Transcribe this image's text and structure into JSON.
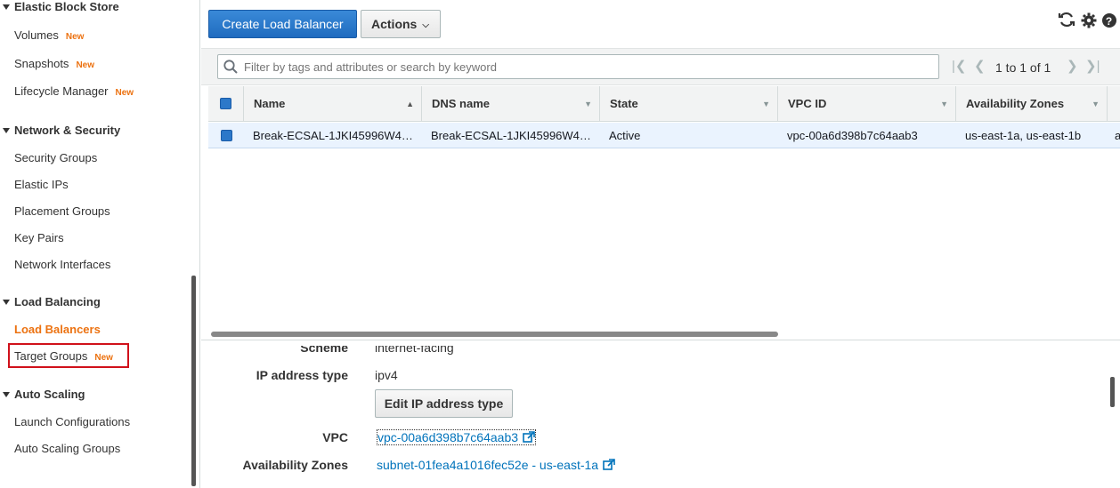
{
  "sidebar": {
    "sections": [
      {
        "label": "Elastic Block Store"
      },
      {
        "label": "Network & Security"
      },
      {
        "label": "Load Balancing"
      },
      {
        "label": "Auto Scaling"
      }
    ],
    "items": [
      {
        "label": "Volumes",
        "badge": "New"
      },
      {
        "label": "Snapshots",
        "badge": "New"
      },
      {
        "label": "Lifecycle Manager",
        "badge": "New"
      },
      {
        "label": "Security Groups"
      },
      {
        "label": "Elastic IPs"
      },
      {
        "label": "Placement Groups"
      },
      {
        "label": "Key Pairs"
      },
      {
        "label": "Network Interfaces"
      },
      {
        "label": "Load Balancers"
      },
      {
        "label": "Target Groups",
        "badge": "New"
      },
      {
        "label": "Launch Configurations"
      },
      {
        "label": "Auto Scaling Groups"
      }
    ]
  },
  "toolbar": {
    "create_label": "Create Load Balancer",
    "actions_label": "Actions"
  },
  "filter": {
    "placeholder": "Filter by tags and attributes or search by keyword"
  },
  "pager": {
    "text": "1 to 1 of 1"
  },
  "table": {
    "columns": [
      "Name",
      "DNS name",
      "State",
      "VPC ID",
      "Availability Zones"
    ],
    "rows": [
      {
        "name": "Break-ECSAL-1JKI45996W4…",
        "dns": "Break-ECSAL-1JKI45996W4…",
        "state": "Active",
        "vpc": "vpc-00a6d398b7c64aab3",
        "azs": "us-east-1a, us-east-1b",
        "extra": "a"
      }
    ]
  },
  "details": {
    "scheme_label": "Scheme",
    "scheme_value": "internet-facing",
    "ip_type_label": "IP address type",
    "ip_type_value": "ipv4",
    "edit_ip_button": "Edit IP address type",
    "vpc_label": "VPC",
    "vpc_value": "vpc-00a6d398b7c64aab3",
    "az_label": "Availability Zones",
    "az_value": "subnet-01fea4a1016fec52e - us-east-1a"
  },
  "colors": {
    "accent": "#ec7211",
    "primary": "#2c78c9",
    "link": "#0073bb",
    "highlight": "#d0111b"
  }
}
